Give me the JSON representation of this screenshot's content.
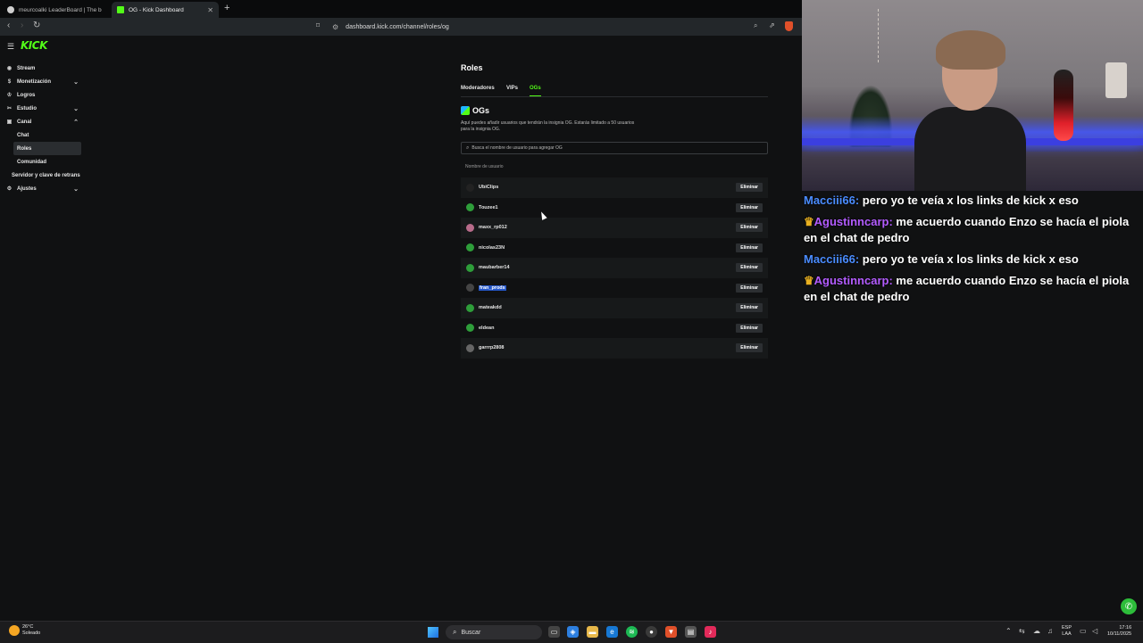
{
  "browser": {
    "tabs": [
      {
        "title": "meurcoalki LeaderBoard | The best (",
        "active": false
      },
      {
        "title": "OG - Kick Dashboard",
        "active": true
      }
    ],
    "url": "dashboard.kick.com/channel/roles/og"
  },
  "sidebar": {
    "brand": "KICK",
    "items": [
      {
        "label": "Stream",
        "icon": "broadcast-icon"
      },
      {
        "label": "Monetización",
        "icon": "money-icon"
      },
      {
        "label": "Logros",
        "icon": "trophy-icon"
      },
      {
        "label": "Estudio",
        "icon": "studio-icon"
      },
      {
        "label": "Canal",
        "icon": "channel-icon"
      }
    ],
    "canal_sub": [
      "Chat",
      "Roles",
      "Comunidad"
    ],
    "server_label": "Servidor y clave de retrans",
    "settings_label": "Ajustes"
  },
  "main": {
    "title": "Roles",
    "tabs": [
      "Moderadores",
      "VIPs",
      "OGs"
    ],
    "active_tab": "OGs",
    "section_title": "OGs",
    "description": "Aquí puedes añadir usuarios que tendrán la insignia OG. Estarás limitado a 50 usuarios para la insignia OG.",
    "search_placeholder": "Busca el nombre de usuario para agregar OG",
    "column_header": "Nombre de usuario",
    "remove_label": "Eliminar",
    "users": [
      "UbiClips",
      "Touzee1",
      "maxx_rp012",
      "nicolas23N",
      "maubarber14",
      "fran_prods",
      "mateakdd",
      "eldean",
      "garrrp2808"
    ]
  },
  "chat": {
    "messages": [
      {
        "user": "Macciii66:",
        "text": "pero yo te veía x los links de kick x eso",
        "color": "#4a8cff",
        "crown": false
      },
      {
        "user": "Agustinncarp:",
        "text": "me acuerdo cuando Enzo se hacía el piola en el chat de pedro",
        "color": "#b35cff",
        "crown": true
      },
      {
        "user": "Macciii66:",
        "text": "pero yo te veía x los links de kick x eso",
        "color": "#4a8cff",
        "crown": false
      },
      {
        "user": "Agustinncarp:",
        "text": "me acuerdo cuando Enzo se hacía el piola en el chat de pedro",
        "color": "#b35cff",
        "crown": true
      }
    ]
  },
  "taskbar": {
    "temp": "26°C",
    "condition": "Soleado",
    "search_label": "Buscar",
    "lang": "ESP",
    "layout": "LAA",
    "time": "17:16",
    "date": "10/11/2025"
  },
  "colors": {
    "accent": "#53fc18",
    "bg": "#101112",
    "button": "#2c2f32"
  }
}
